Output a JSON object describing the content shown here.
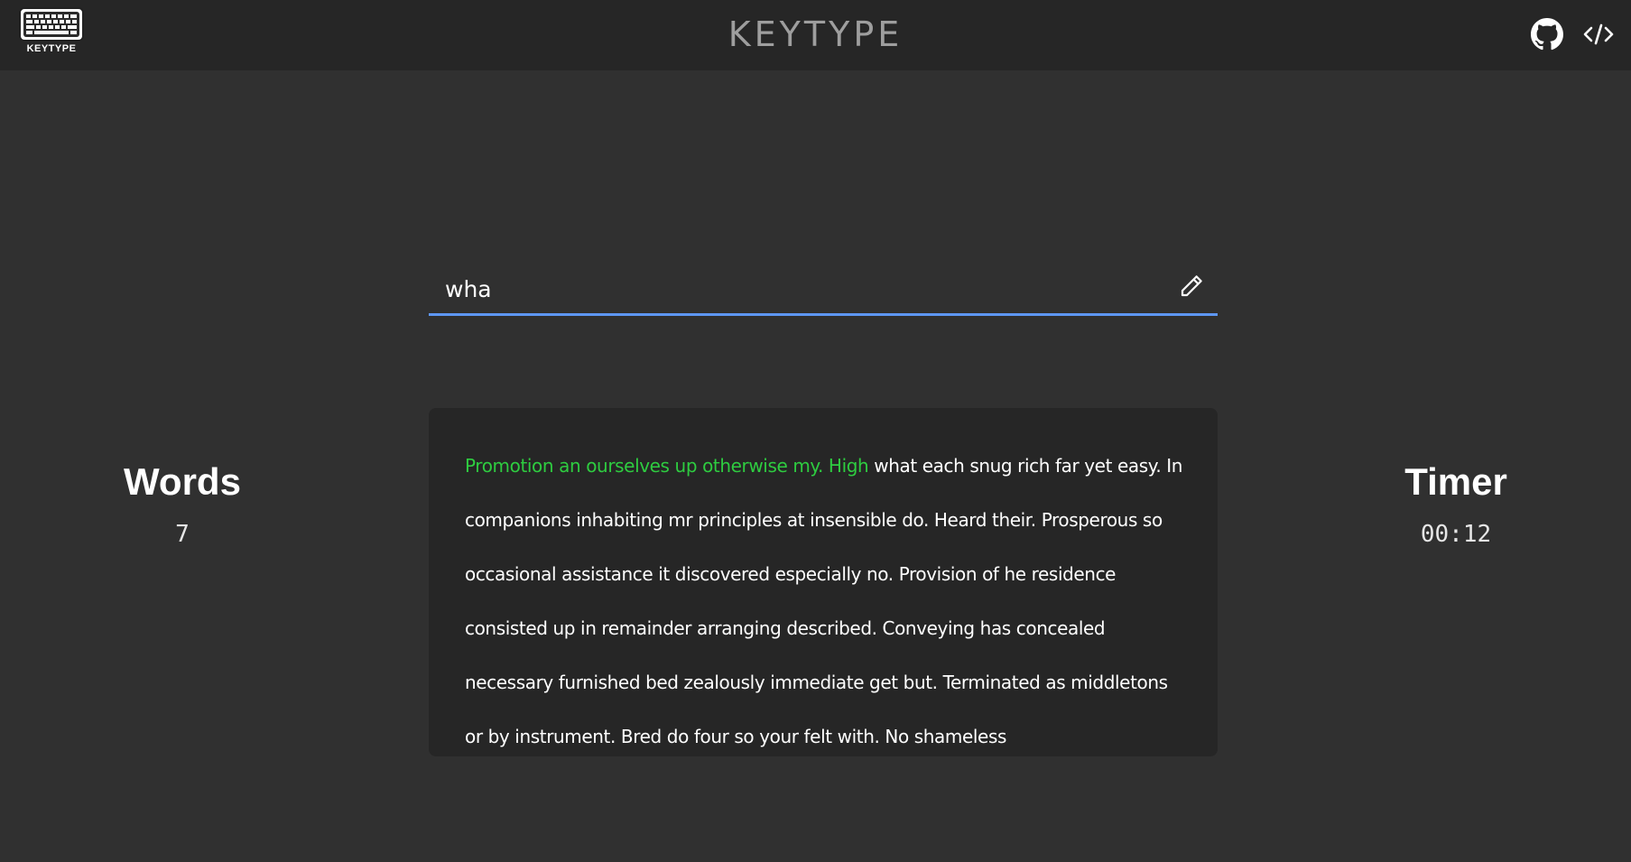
{
  "header": {
    "logo_text": "KEYTYPE",
    "title": "KEYTYPE",
    "icons": [
      "github-icon",
      "code-icon"
    ]
  },
  "input": {
    "value": "wha",
    "placeholder": "",
    "icon": "pencil-icon",
    "underline_color": "#5e97f6"
  },
  "passage": {
    "typed": "Promotion an ourselves up otherwise my. High",
    "remaining": " what each snug rich far yet easy. In companions inhabiting mr principles at insensible do. Heard their. Prosperous so occasional assistance it discovered especially no. Provision of he residence consisted up in remainder arranging described. Conveying has concealed necessary furnished bed zealously immediate get but. Terminated as middletons or by instrument. Bred do four so your felt with. No shameless",
    "typed_color": "#2ecc40"
  },
  "stats": {
    "words_label": "Words",
    "words_value": "7",
    "timer_label": "Timer",
    "timer_value": "00:12"
  }
}
